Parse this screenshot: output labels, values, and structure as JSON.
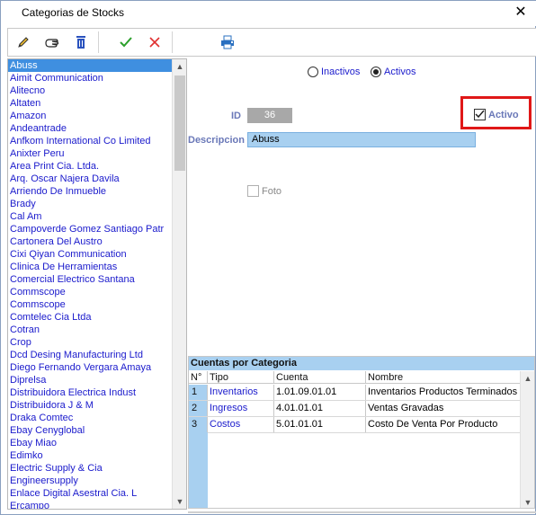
{
  "window": {
    "title": "Categorias de Stocks",
    "close_glyph": "✕"
  },
  "toolbar": {
    "buttons": [
      {
        "name": "edit-pencil-icon",
        "color": "#c09020"
      },
      {
        "name": "search-hand-icon",
        "color": "#333333"
      },
      {
        "name": "delete-trash-icon",
        "color": "#2a52be"
      },
      {
        "name": "accept-check-icon",
        "color": "#2ca02c"
      },
      {
        "name": "cancel-x-icon",
        "color": "#e03030"
      },
      {
        "name": "print-report-icon",
        "color": "#2a70c0"
      }
    ]
  },
  "list": {
    "selected_index": 0,
    "items": [
      "Abuss",
      "Aimit Communication",
      "Alitecno",
      "Altaten",
      "Amazon",
      "Andeantrade",
      "Anfkom International Co Limited",
      "Anixter Peru",
      "Area Print Cia. Ltda.",
      "Arq. Oscar Najera Davila",
      "Arriendo De Inmueble",
      "Brady",
      "Cal Am",
      "Campoverde Gomez Santiago Patr",
      "Cartonera Del Austro",
      "Cixi Qiyan Communication",
      "Clinica De Herramientas",
      "Comercial Electrico Santana",
      "Commscope",
      "Commscope",
      "Comtelec Cia Ltda",
      "Cotran",
      "Crop",
      "Dcd Desing Manufacturing Ltd",
      "Diego Fernando Vergara Amaya",
      "Diprelsa",
      "Distribuidora Electrica Indust",
      "Distribuidora J & M",
      "Draka Comtec",
      "Ebay Cenyglobal",
      "Ebay Miao",
      "Edimko",
      "Electric Supply & Cia",
      "Engineersupply",
      "Enlace Digital Asestral Cia. L",
      "Ercampo"
    ]
  },
  "filter": {
    "inactive_label": "Inactivos",
    "active_label": "Activos",
    "selected": "Activos"
  },
  "form": {
    "id_label": "ID",
    "id_value": "36",
    "desc_label": "Descripcion",
    "desc_value": "Abuss",
    "activo_label": "Activo",
    "activo_checked": true,
    "foto_label": "Foto",
    "foto_checked": false
  },
  "grid": {
    "title": "Cuentas por Categoria",
    "headers": [
      "N°",
      "Tipo",
      "Cuenta",
      "Nombre"
    ],
    "rows": [
      {
        "n": "1",
        "tipo": "Inventarios",
        "cuenta": "1.01.09.01.01",
        "nombre": "Inventarios Productos Terminados"
      },
      {
        "n": "2",
        "tipo": "Ingresos",
        "cuenta": "4.01.01.01",
        "nombre": "Ventas Gravadas"
      },
      {
        "n": "3",
        "tipo": "Costos",
        "cuenta": "5.01.01.01",
        "nombre": "Costo De Venta Por Producto"
      }
    ]
  },
  "colors": {
    "selection": "#3f8fe0",
    "highlight_border": "#e01818",
    "link_text": "#1a1acc",
    "label_text": "#6a78b8"
  }
}
